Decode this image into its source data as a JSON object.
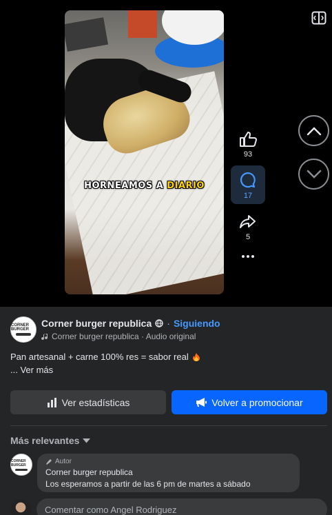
{
  "video": {
    "caption_part1": "HORNEAMOS A",
    "caption_highlight": "DIARIO"
  },
  "actions": {
    "likes": "93",
    "comments": "17",
    "shares": "5"
  },
  "author": {
    "name": "Corner burger republica",
    "separator": "·",
    "follow_status": "Siguiendo",
    "audio": "Corner burger republica · Audio original"
  },
  "post": {
    "description": "Pan artesanal + carne 100% res = sabor real",
    "see_more": "... Ver más"
  },
  "buttons": {
    "stats": "Ver estadísticas",
    "promote": "Volver a promocionar"
  },
  "comments": {
    "sort_label": "Más relevantes",
    "items": [
      {
        "badge": "Autor",
        "author": "Corner burger republica",
        "text": "Los esperamos a partir de las 6 pm de martes a sábado"
      }
    ],
    "composer_placeholder": "Comentar como Angel Rodriguez"
  },
  "avatar_text": "CORNER BURGER",
  "colors": {
    "accent": "#0866ff",
    "link": "#4599ff",
    "panel": "#242526"
  }
}
